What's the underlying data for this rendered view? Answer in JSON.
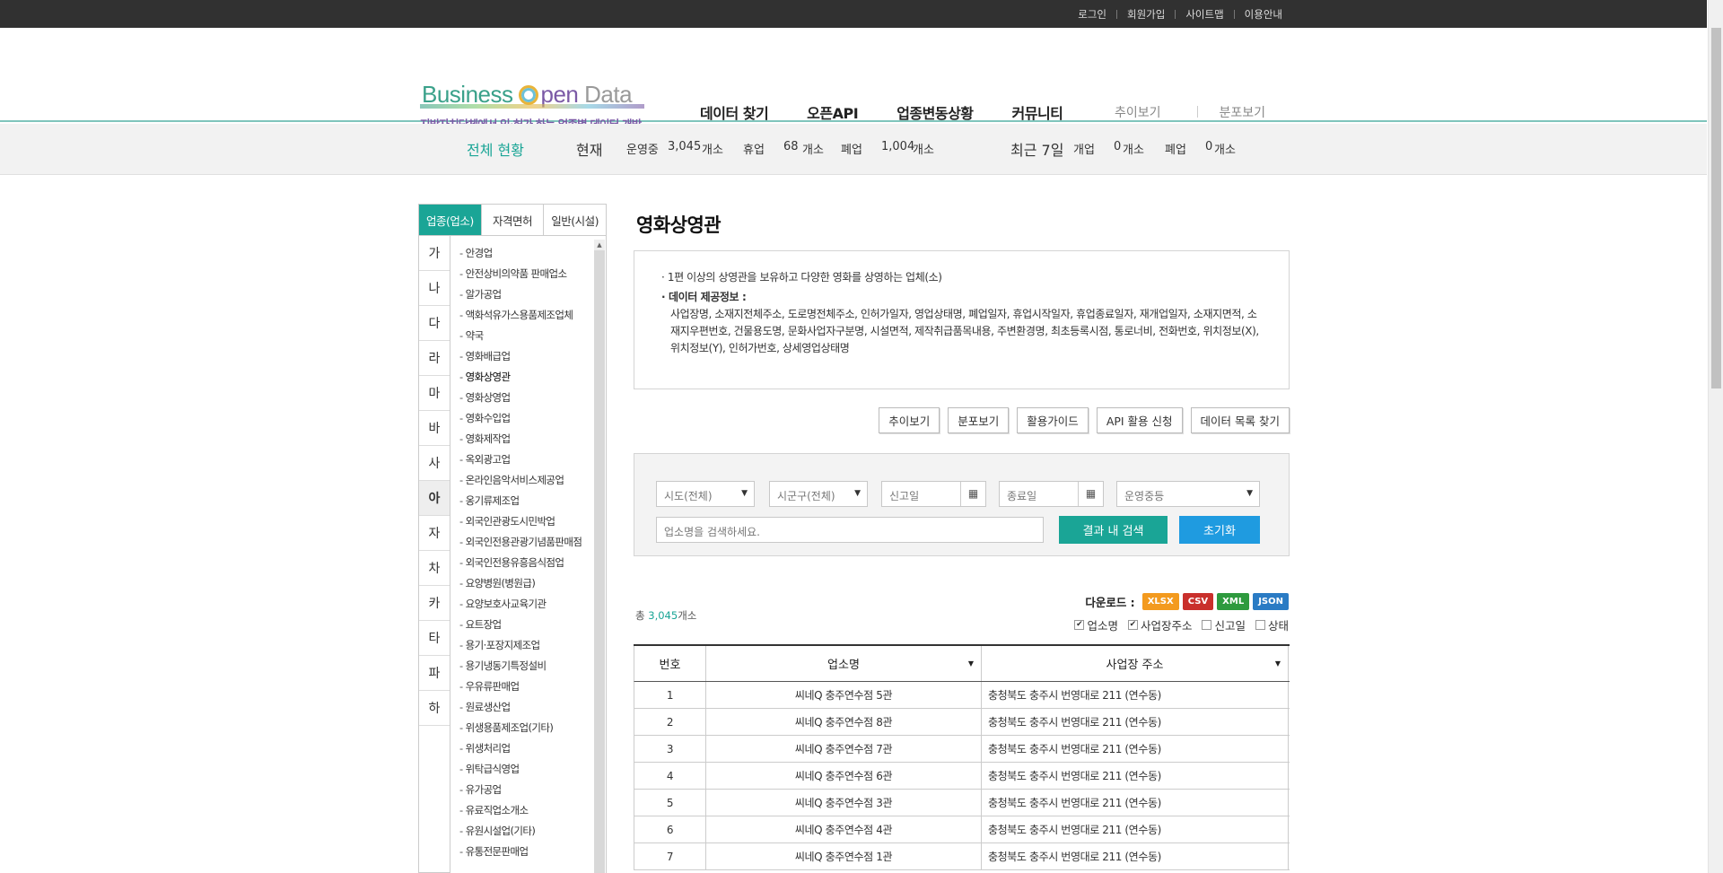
{
  "util_links": [
    "로그인",
    "회원가입",
    "사이트맵",
    "이용안내"
  ],
  "logo": {
    "business": "Business",
    "open": "pen",
    "data": "Data",
    "tagline": "지방자치단체에서 인·허가 하는 업종별 데이터 개방"
  },
  "gnav": [
    "데이터 찾기",
    "오픈API",
    "업종변동상황",
    "커뮤니티"
  ],
  "gnav2": [
    "추이보기",
    "분포보기"
  ],
  "status": {
    "title": "전체 현황",
    "now_label": "현재",
    "operating_label": "운영중",
    "operating": "3,045",
    "unit": "개소",
    "closed_temp_label": "휴업",
    "closed_temp": "68",
    "closed_label": "폐업",
    "closed": "1,004",
    "recent_label": "최근 7일",
    "opened_label": "개업",
    "opened": "0",
    "recent_closed_label": "폐업",
    "recent_closed": "0"
  },
  "tabs": [
    "업종(업소)",
    "자격면허",
    "일반(시설)"
  ],
  "index": [
    "가",
    "나",
    "다",
    "라",
    "마",
    "바",
    "사",
    "아",
    "자",
    "차",
    "카",
    "타",
    "파",
    "하"
  ],
  "categories": [
    "안경업",
    "안전상비의약품 판매업소",
    "알가공업",
    "액화석유가스용품제조업체",
    "약국",
    "영화배급업",
    "영화상영관",
    "영화상영업",
    "영화수입업",
    "영화제작업",
    "옥외광고업",
    "온라인음악서비스제공업",
    "옹기류제조업",
    "외국인관광도시민박업",
    "외국인전용관광기념품판매점",
    "외국인전용유흥음식점업",
    "요양병원(병원급)",
    "요양보호사교육기관",
    "요트장업",
    "용기·포장지제조업",
    "용기냉동기특정설비",
    "우유류판매업",
    "원료생산업",
    "위생용품제조업(기타)",
    "위생처리업",
    "위탁급식영업",
    "유가공업",
    "유료직업소개소",
    "유원시설업(기타)",
    "유통전문판매업"
  ],
  "page": {
    "title": "영화상영관",
    "desc1": "1편 이상의 상영관을 보유하고 다양한 영화를 상영하는 업체(소)",
    "desc2": "데이터 제공정보 :",
    "desc3": "사업장명, 소재지전체주소, 도로명전체주소, 인허가일자, 영업상태명, 폐업일자, 휴업시작일자, 휴업종료일자, 재개업일자, 소재지면적, 소재지우편번호, 건물용도명, 문화사업자구분명, 시설면적, 제작취급품목내용, 주변환경명, 최초등록시점, 통로너비, 전화번호, 위치정보(X), 위치정보(Y), 인허가번호, 상세영업상태명"
  },
  "buttons": [
    "추이보기",
    "분포보기",
    "활용가이드",
    "API 활용 신청",
    "데이터 목록 찾기"
  ],
  "search": {
    "sido": "시도(전체)",
    "sigungu": "시군구(전체)",
    "start": "신고일",
    "end": "종료일",
    "status": "운영중등",
    "keyword_placeholder": "업소명을 검색하세요.",
    "search_btn": "결과 내 검색",
    "reset_btn": "초기화"
  },
  "result": {
    "total_prefix": "총",
    "total": "3,045",
    "total_suffix": "개소"
  },
  "download": {
    "label": "다운로드 :",
    "formats": [
      {
        "name": "XLSX",
        "color": "#f39a1e"
      },
      {
        "name": "CSV",
        "color": "#c9302c"
      },
      {
        "name": "XML",
        "color": "#2e9a3e"
      },
      {
        "name": "JSON",
        "color": "#2a7bc4"
      }
    ]
  },
  "columns_check": [
    {
      "label": "업소명",
      "checked": "✔"
    },
    {
      "label": "사업장주소",
      "checked": "✔"
    },
    {
      "label": "신고일",
      "checked": ""
    },
    {
      "label": "상태",
      "checked": ""
    }
  ],
  "table": {
    "headers": [
      "번호",
      "업소명",
      "사업장 주소"
    ],
    "rows": [
      [
        "1",
        "씨네Q 충주연수점 5관",
        "충청북도 충주시 번영대로 211 (연수동)"
      ],
      [
        "2",
        "씨네Q 충주연수점 8관",
        "충청북도 충주시 번영대로 211 (연수동)"
      ],
      [
        "3",
        "씨네Q 충주연수점 7관",
        "충청북도 충주시 번영대로 211 (연수동)"
      ],
      [
        "4",
        "씨네Q 충주연수점 6관",
        "충청북도 충주시 번영대로 211 (연수동)"
      ],
      [
        "5",
        "씨네Q 충주연수점 3관",
        "충청북도 충주시 번영대로 211 (연수동)"
      ],
      [
        "6",
        "씨네Q 충주연수점 4관",
        "충청북도 충주시 번영대로 211 (연수동)"
      ],
      [
        "7",
        "씨네Q 충주연수점 1관",
        "충청북도 충주시 번영대로 211 (연수동)"
      ]
    ]
  }
}
